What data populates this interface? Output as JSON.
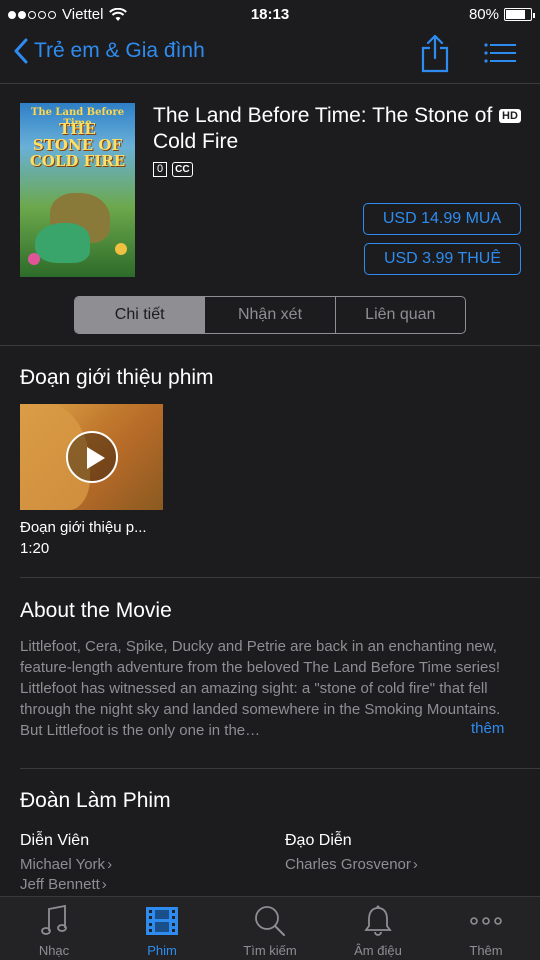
{
  "status_bar": {
    "carrier": "Viettel",
    "time": "18:13",
    "battery": "80%",
    "battery_level": 0.8
  },
  "nav": {
    "back_label": "Trẻ em & Gia đình",
    "share_icon": "share-icon",
    "list_icon": "list-icon"
  },
  "movie": {
    "title": "The Land Before Time: The Stone of Cold Fire",
    "hd_badge": "HD",
    "rating": "0",
    "cc_badge": "CC",
    "poster": {
      "line1": "The Land Before Time",
      "line2": "THE",
      "line3": "STONE OF",
      "line4": "COLD FIRE"
    },
    "buy_label": "USD 14.99 MUA",
    "rent_label": "USD 3.99 THUÊ"
  },
  "tabs_segment": [
    {
      "label": "Chi tiết",
      "active": true
    },
    {
      "label": "Nhận xét",
      "active": false
    },
    {
      "label": "Liên quan",
      "active": false
    }
  ],
  "trailer": {
    "section_title": "Đoạn giới thiệu phim",
    "name": "Đoạn giới thiệu p...",
    "duration": "1:20"
  },
  "about": {
    "section_title": "About the Movie",
    "text": "Littlefoot, Cera, Spike, Ducky and Petrie are back in an enchanting new, feature-length adventure from the beloved The Land Before Time series! Littlefoot has witnessed an amazing sight: a \"stone of cold fire\" that fell through the night sky and landed somewhere in the Smoking Mountains. But Littlefoot is the only one in the…",
    "more_label": "thêm"
  },
  "crew": {
    "section_title": "Đoàn Làm Phim",
    "actors_label": "Diễn Viên",
    "actors": [
      "Michael York",
      "Jeff Bennett"
    ],
    "director_label": "Đạo Diễn",
    "directors": [
      "Charles Grosvenor"
    ]
  },
  "tab_bar": [
    {
      "label": "Nhạc",
      "icon": "music-note-icon",
      "active": false
    },
    {
      "label": "Phim",
      "icon": "film-icon",
      "active": true
    },
    {
      "label": "Tìm kiếm",
      "icon": "search-icon",
      "active": false
    },
    {
      "label": "Âm điệu",
      "icon": "bell-icon",
      "active": false
    },
    {
      "label": "Thêm",
      "icon": "more-icon",
      "active": false
    }
  ],
  "colors": {
    "accent": "#2e8cf0",
    "background": "#1c1c1e",
    "secondary_text": "#8e8e93"
  }
}
